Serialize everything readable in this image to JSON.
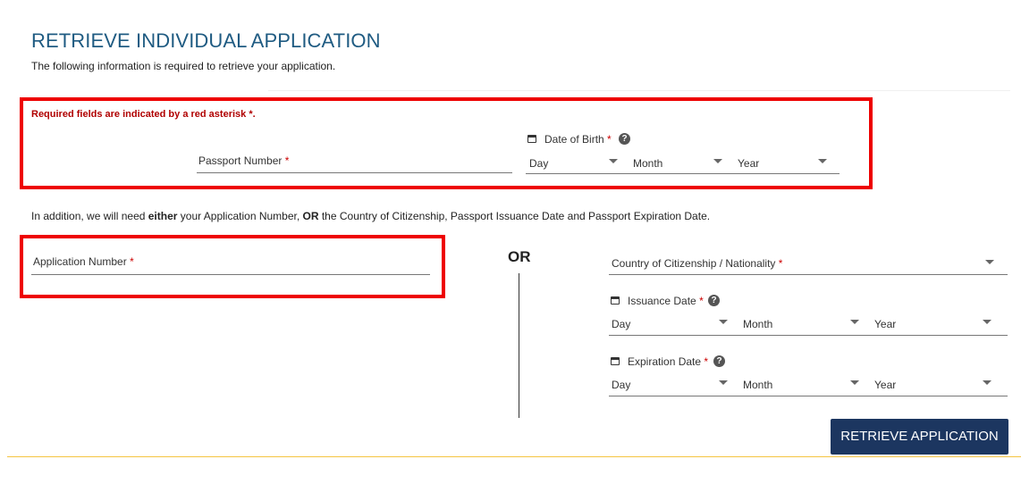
{
  "page": {
    "title": "RETRIEVE INDIVIDUAL APPLICATION",
    "subtitle": "The following information is required to retrieve your application."
  },
  "required_note": {
    "text": "Required fields are indicated by a red asterisk ",
    "asterisk": "*",
    "period": "."
  },
  "passport_number": {
    "label": "Passport Number",
    "asterisk": "*",
    "value": ""
  },
  "date_of_birth": {
    "label": "Date of Birth",
    "asterisk": "*",
    "help": "?",
    "day": "Day",
    "month": "Month",
    "year": "Year"
  },
  "info_text": {
    "part1": "In addition, we will need ",
    "bold1": "either",
    "part2": " your Application Number, ",
    "bold2": "OR",
    "part3": " the Country of Citizenship, Passport Issuance Date and Passport Expiration Date."
  },
  "application_number": {
    "label": "Application Number",
    "asterisk": "*",
    "value": ""
  },
  "or_divider": "OR",
  "country": {
    "label": "Country of Citizenship / Nationality",
    "asterisk": "*"
  },
  "issuance_date": {
    "label": "Issuance Date",
    "asterisk": "*",
    "help": "?",
    "day": "Day",
    "month": "Month",
    "year": "Year"
  },
  "expiration_date": {
    "label": "Expiration Date",
    "asterisk": "*",
    "help": "?",
    "day": "Day",
    "month": "Month",
    "year": "Year"
  },
  "submit_button": "RETRIEVE APPLICATION",
  "colors": {
    "title": "#1f5b82",
    "highlight": "#ee0000",
    "required": "#cc0000",
    "button": "#1c3660",
    "footer_line": "#f5c542"
  }
}
